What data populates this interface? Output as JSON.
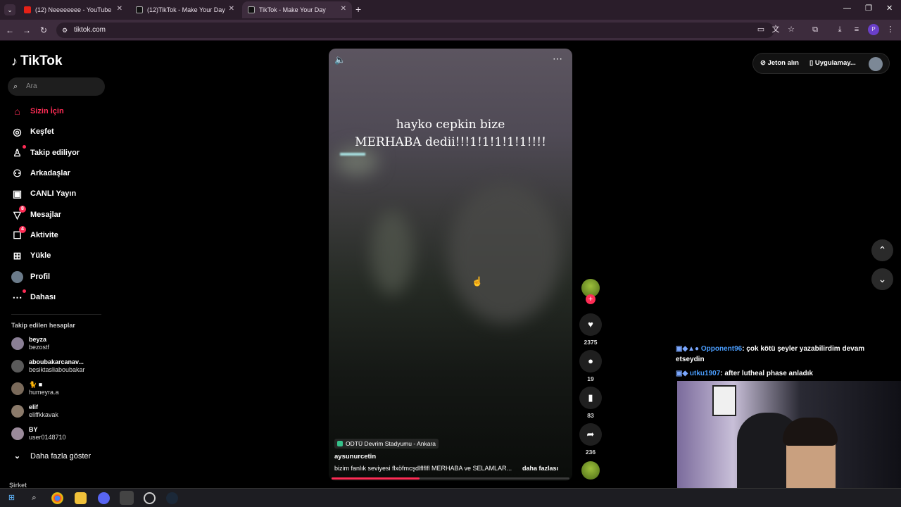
{
  "browser": {
    "tabs": [
      {
        "title": "(12) Neeeeeeee - YouTube",
        "icon": "youtube-icon"
      },
      {
        "title": "(12)TikTok - Make Your Day",
        "icon": "tiktok-icon"
      },
      {
        "title": "TikTok - Make Your Day",
        "icon": "tiktok-icon"
      }
    ],
    "url": "tiktok.com",
    "profile_initial": "P"
  },
  "tiktok": {
    "logo": "TikTok",
    "search_placeholder": "Ara",
    "nav": [
      {
        "label": "Sizin İçin",
        "icon": "home-icon",
        "active": true
      },
      {
        "label": "Keşfet",
        "icon": "compass-icon"
      },
      {
        "label": "Takip ediliyor",
        "icon": "following-icon"
      },
      {
        "label": "Arkadaşlar",
        "icon": "friends-icon"
      },
      {
        "label": "CANLI Yayın",
        "icon": "live-icon"
      },
      {
        "label": "Mesajlar",
        "icon": "messages-icon",
        "badge": "8"
      },
      {
        "label": "Aktivite",
        "icon": "activity-icon",
        "badge": "4"
      },
      {
        "label": "Yükle",
        "icon": "upload-icon"
      },
      {
        "label": "Profil",
        "icon": "profile-icon"
      },
      {
        "label": "Dahası",
        "icon": "more-icon"
      }
    ],
    "following_header": "Takip edilen hesaplar",
    "accounts": [
      {
        "name": "beyza",
        "handle": "bezostf"
      },
      {
        "name": "aboubakarcanav...",
        "handle": "besiktasliaboubakar"
      },
      {
        "name": "",
        "handle": "humeyra.a"
      },
      {
        "name": "elif",
        "handle": "eliffkkavak"
      },
      {
        "name": "BY",
        "handle": "user0148710"
      }
    ],
    "show_more": "Daha fazla göster",
    "company": "Şirket",
    "top_right": {
      "coins": "Jeton alın",
      "app": "Uygulamay..."
    },
    "video": {
      "overlay_line1": "hayko cepkin bize",
      "overlay_line2": "MERHABA dedii!!!1!1!1!1!1!!!!",
      "location": "ODTÜ Devrim Stadyumu - Ankara",
      "username": "aysunurcetin",
      "description": "bizim fanlık seviyesi flxöfmcşdlflflfl MERHABA ve SELAMLAR...",
      "more": "daha fazlası",
      "progress": 0.37
    },
    "actions": {
      "likes": "2375",
      "comments": "19",
      "saves": "83",
      "shares": "236"
    }
  },
  "stream_chat": [
    {
      "user": "Opponent96",
      "text": ": çok kötü şeyler yazabilirdim devam etseydin"
    },
    {
      "user": "utku1907",
      "text": ": after lutheal phase anladık"
    }
  ],
  "colors": {
    "accent": "#fe2c55",
    "chat_user": "#4a9eff"
  }
}
